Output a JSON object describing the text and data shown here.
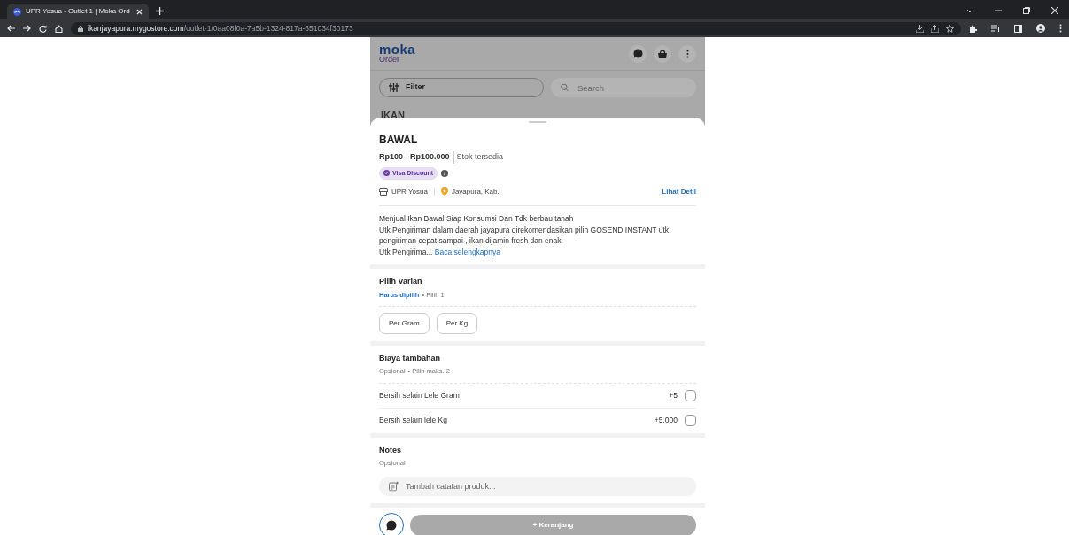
{
  "browser": {
    "tab": {
      "title": "UPR Yosua - Outlet 1 | Moka Ord",
      "selected": true
    },
    "url_host": "ikanjayapura.mygostore.com",
    "url_path": "/outlet-1/0aa08f0a-7a5b-1324-817a-651034f30173"
  },
  "header": {
    "logo": "moka",
    "logo_sub": "Order"
  },
  "toolbar": {
    "filter": "Filter",
    "search_placeholder": "Search"
  },
  "category": "IKAN",
  "product": {
    "name": "BAWAL",
    "price": "Rp100 - Rp100.000",
    "stock": "Stok tersedia",
    "badge": "Visa Discount",
    "store": "UPR Yosua",
    "location": "Jayapura, Kab.",
    "detail_link": "Lihat Detil",
    "description": "Menjual Ikan Bawal Siap Konsumsi Dan Tdk berbau tanah\nUtk Pengiriman dalam daerah jayapura direkomendasikan pilih GOSEND INSTANT utk pengiriman cepat sampai , ikan dijamin fresh dan enak\nUtk Pengirima...",
    "read_more": "Baca selengkapnya"
  },
  "variants": {
    "title": "Pilih Varian",
    "required": "Harus dipilih",
    "rule": "• Pilih 1",
    "options": [
      {
        "label": "Per Gram",
        "selected": false
      },
      {
        "label": "Per Kg",
        "selected": false
      }
    ]
  },
  "addons": {
    "title": "Biaya tambahan",
    "optional": "Opsional",
    "rule": "• Pilih maks. 2",
    "items": [
      {
        "name": "Bersih selain Lele Gram",
        "price": "+5",
        "checked": false
      },
      {
        "name": "Bersih selain lele Kg",
        "price": "+5.000",
        "checked": false
      }
    ]
  },
  "notes": {
    "title": "Notes",
    "optional": "Opsional",
    "placeholder": "Tambah catatan produk..."
  },
  "cart_button": {
    "label": "+ Keranjang",
    "disabled": true
  }
}
